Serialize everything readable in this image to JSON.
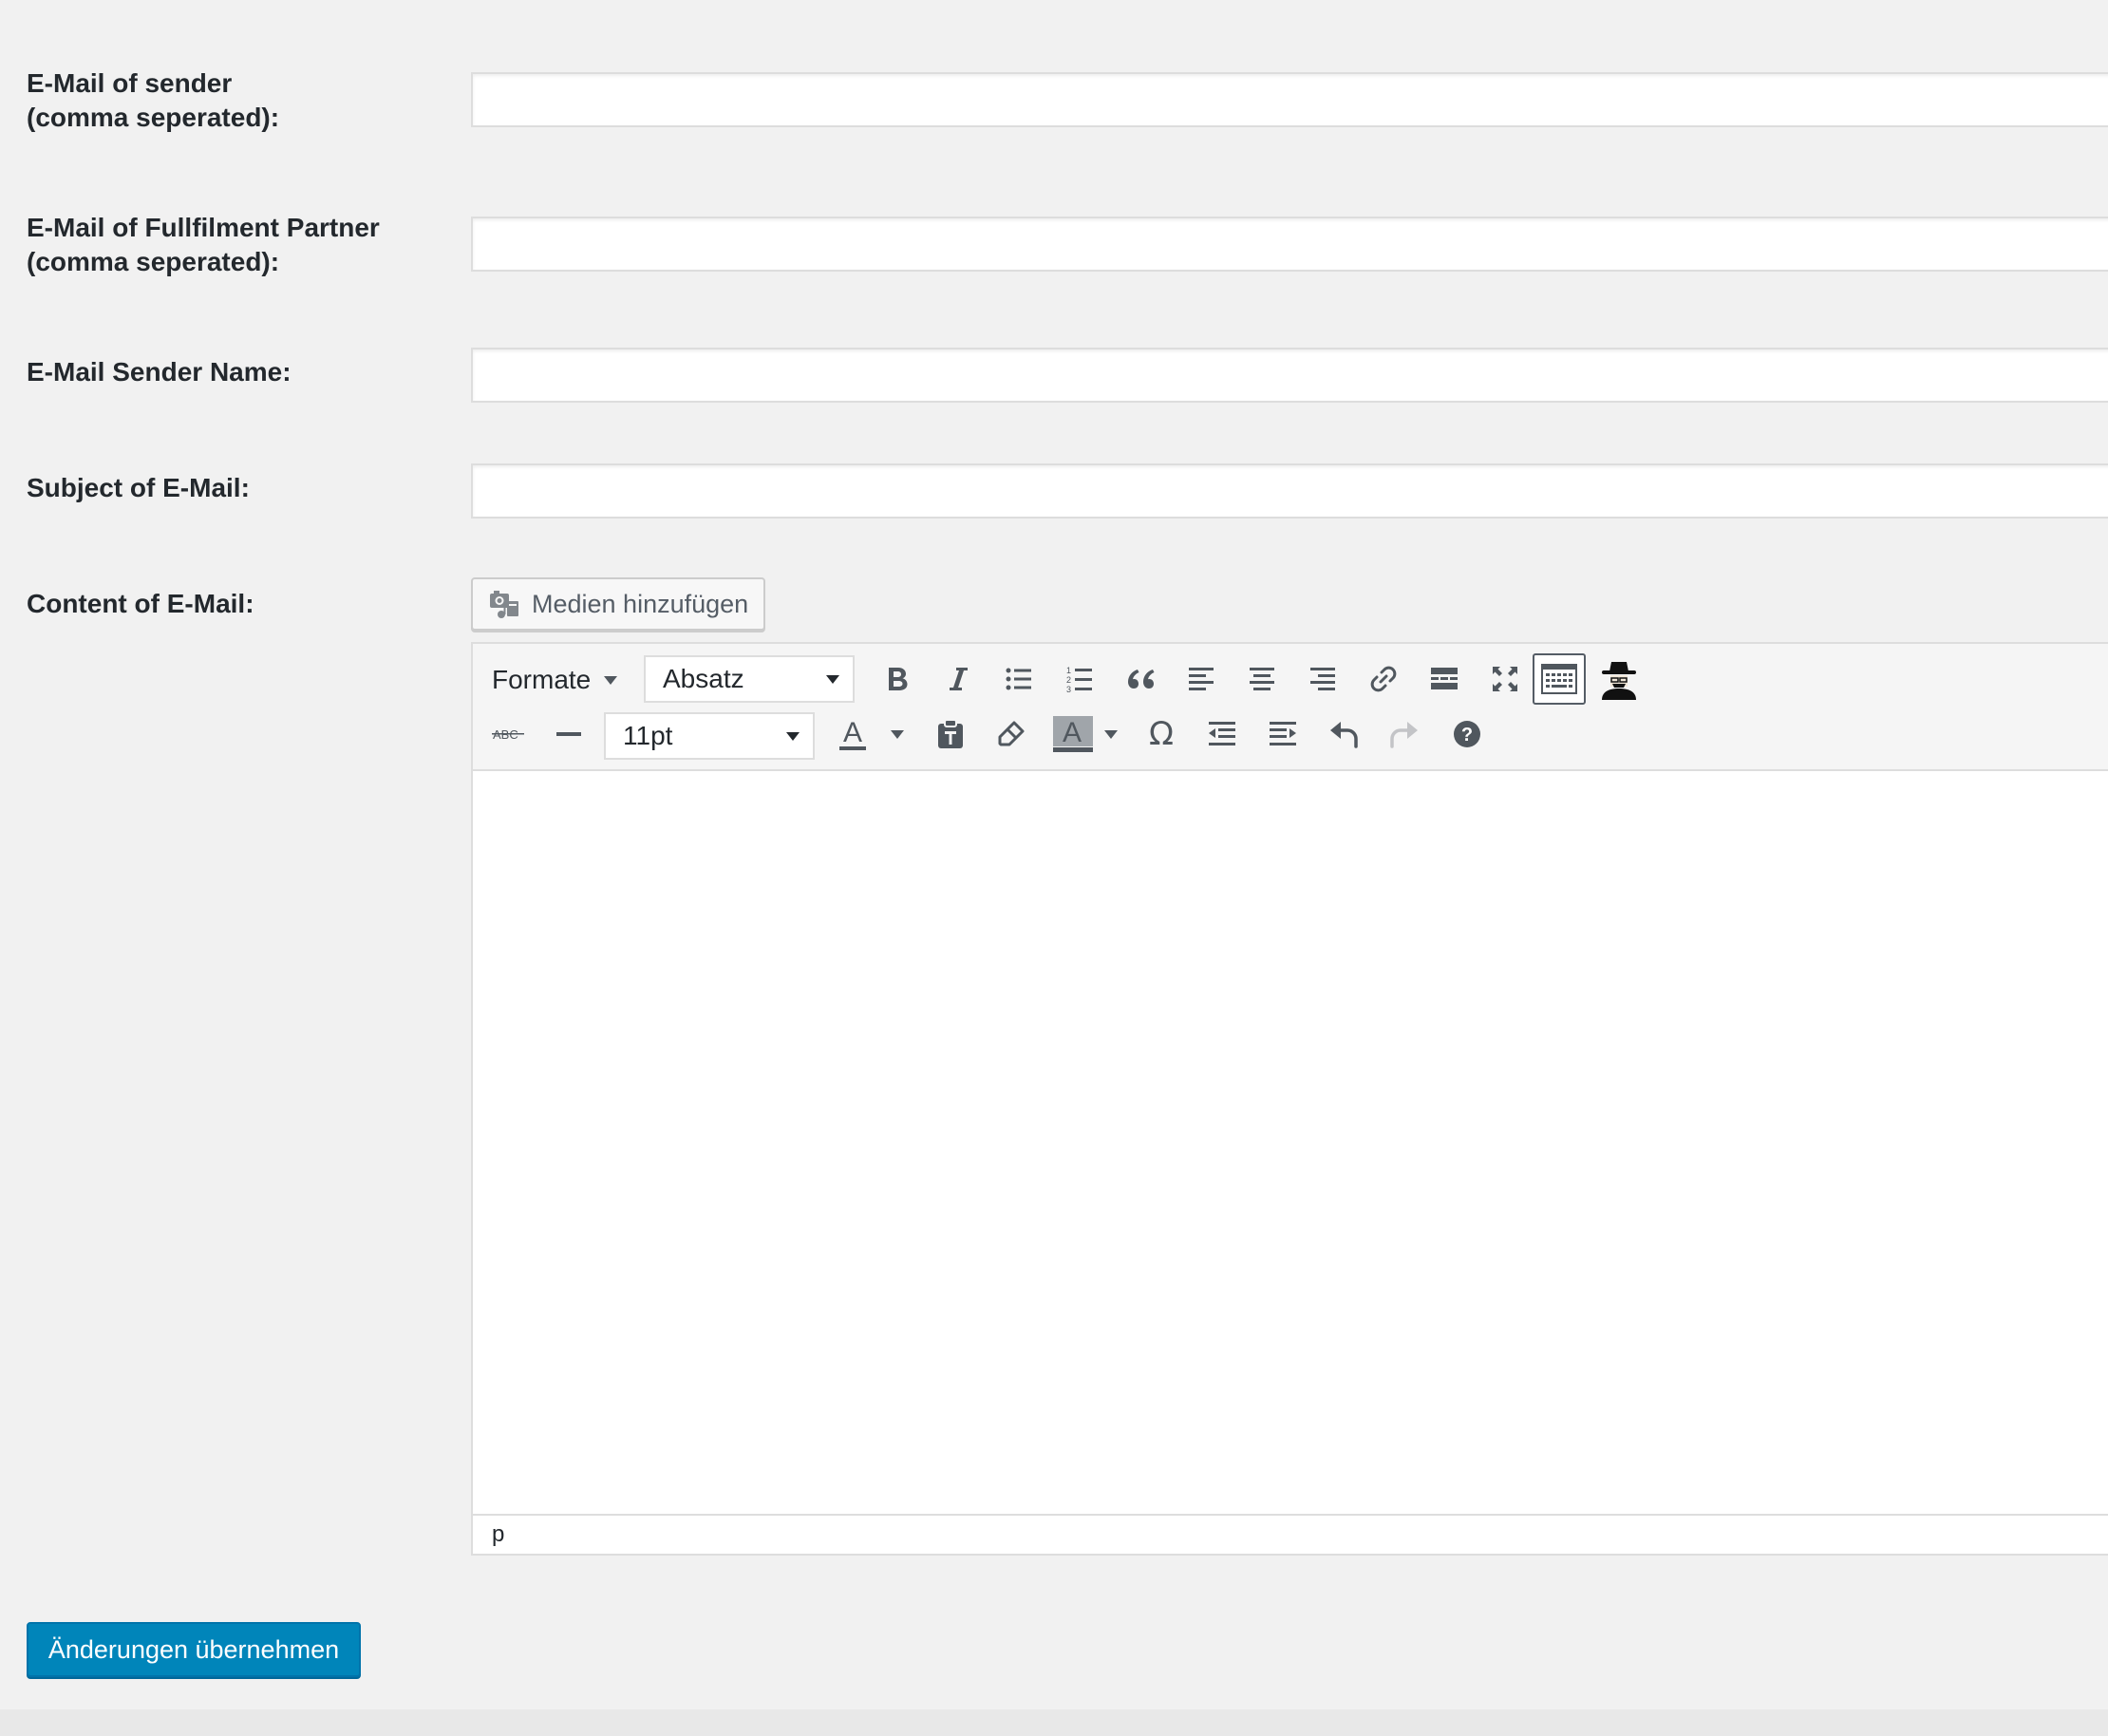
{
  "form": {
    "fields": [
      {
        "label_line1": "E-Mail of sender",
        "label_line2": "(comma seperated):",
        "value": "",
        "placeholder": ""
      },
      {
        "label_line1": "E-Mail of Fullfilment Partner",
        "label_line2": "(comma seperated):",
        "value": "",
        "placeholder": ""
      },
      {
        "label_line1": "E-Mail Sender Name:",
        "value": "",
        "placeholder": ""
      },
      {
        "label_line1": "Subject of E-Mail:",
        "value": "",
        "placeholder": ""
      }
    ],
    "content_label": "Content of E-Mail:",
    "media_button_label": "Medien hinzufügen",
    "submit_label": "Änderungen übernehmen"
  },
  "editor": {
    "formats_label": "Formate",
    "block_format_value": "Absatz",
    "font_size_value": "11pt",
    "status_path": "p",
    "toolbar_row1": [
      "formats-menu",
      "block-format-select",
      "bold-icon",
      "italic-icon",
      "bulleted-list-icon",
      "numbered-list-icon",
      "blockquote-icon",
      "align-left-icon",
      "align-center-icon",
      "align-right-icon",
      "link-icon",
      "read-more-icon",
      "fullscreen-icon",
      "toolbar-toggle-icon",
      "spy-icon"
    ],
    "toolbar_row2": [
      "strikethrough-icon",
      "horizontal-line-icon",
      "font-size-select",
      "text-color-icon",
      "paste-as-text-icon",
      "clear-formatting-icon",
      "background-color-icon",
      "special-character-icon",
      "outdent-icon",
      "indent-icon",
      "undo-icon",
      "redo-icon",
      "help-icon"
    ],
    "strikethrough_glyph": "ABC",
    "text_color_glyph": "A",
    "background_color_glyph": "A",
    "special_char_glyph": "Ω",
    "help_glyph": "?"
  },
  "colors": {
    "primary_button": "#0085ba",
    "page_background": "#f1f1f1",
    "icon_color": "#50575e"
  }
}
